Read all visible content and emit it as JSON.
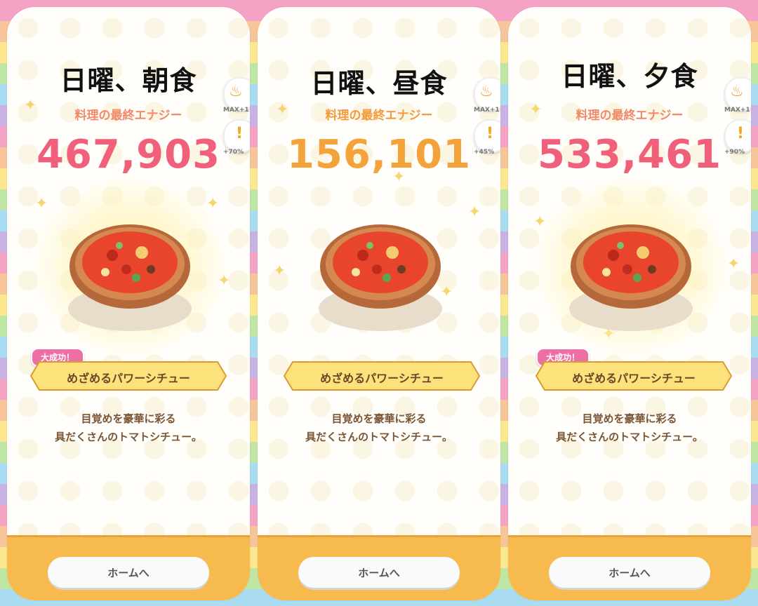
{
  "panels": [
    {
      "title": "日曜、朝食",
      "energy_label": "料理の最終エナジー",
      "energy_value": "467,903",
      "energy_color": "#f1607a",
      "badge_top_caption": "MAX+1",
      "badge_bottom_caption": "+70%",
      "great_success": "大成功！",
      "dish_name": "めざめるパワーシチュー",
      "desc_line1": "目覚めを豪華に彩る",
      "desc_line2": "具だくさんのトマトシチュー。",
      "home_button": "ホームへ"
    },
    {
      "title": "日曜、昼食",
      "energy_label": "料理の最終エナジー",
      "energy_value": "156,101",
      "energy_color": "#f3a33a",
      "badge_top_caption": "MAX+1",
      "badge_bottom_caption": "+45%",
      "great_success": "",
      "dish_name": "めざめるパワーシチュー",
      "desc_line1": "目覚めを豪華に彩る",
      "desc_line2": "具だくさんのトマトシチュー。",
      "home_button": "ホームへ"
    },
    {
      "title": "日曜、夕食",
      "energy_label": "料理の最終エナジー",
      "energy_value": "533,461",
      "energy_color": "#f1607a",
      "badge_top_caption": "MAX+1",
      "badge_bottom_caption": "+90%",
      "great_success": "大成功！",
      "dish_name": "めざめるパワーシチュー",
      "desc_line1": "目覚めを豪華に彩る",
      "desc_line2": "具だくさんのトマトシチュー。",
      "home_button": "ホームへ"
    }
  ]
}
